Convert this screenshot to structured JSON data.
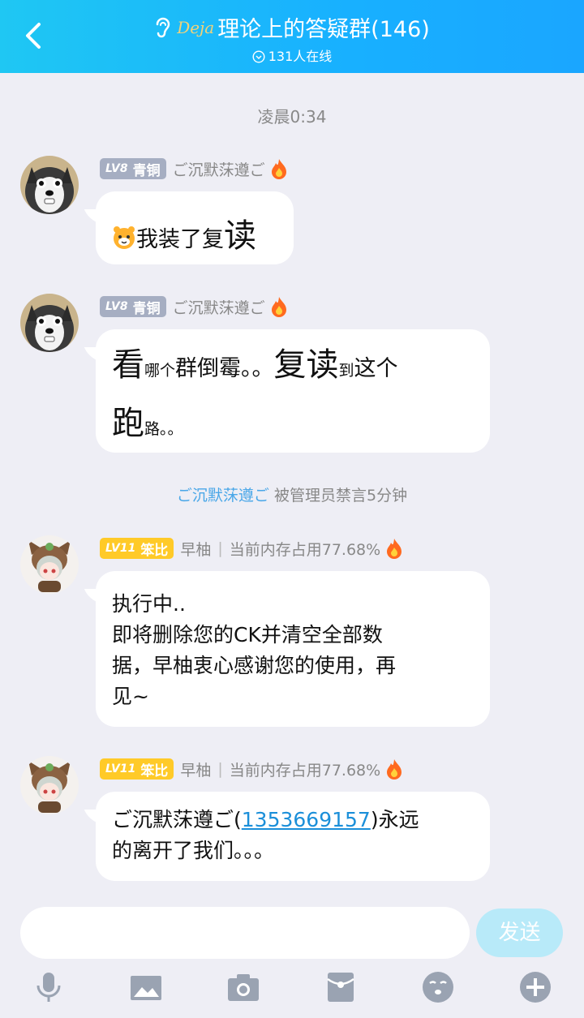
{
  "header": {
    "title": "理论上的答疑群(146)",
    "deja_logo": "Deja",
    "online": "131人在线"
  },
  "time_divider": "凌晨0:34",
  "messages": [
    {
      "level": "LV8",
      "rank": "青铜",
      "name": "ご沉默莯遵ご",
      "parts": [
        "我装了复",
        "读"
      ]
    },
    {
      "level": "LV8",
      "rank": "青铜",
      "name": "ご沉默莯遵ご",
      "parts": [
        "看",
        "哪个",
        "群倒霉。。",
        "复读",
        "到",
        "这个",
        "跑",
        "路。。"
      ]
    },
    {
      "level": "LV11",
      "rank": "笨比",
      "name": "早柚",
      "status": "当前内存占用77.68%",
      "text": [
        "执行中..",
        "即将删除您的CK并清空全部数",
        "据，早柚衷心感谢您的使用，再",
        "见~"
      ]
    },
    {
      "level": "LV11",
      "rank": "笨比",
      "name": "早柚",
      "status": "当前内存占用77.68%",
      "text_before": "ご沉默莯遵ご(",
      "link": "1353669157",
      "text_after": ")永远",
      "text_line2": "的离开了我们。。。"
    }
  ],
  "system_notice": {
    "who": "ご沉默莯遵ご",
    "text": " 被管理员禁言5分钟"
  },
  "input": {
    "send_label": "发送"
  },
  "colors": {
    "header": "#18b0ff",
    "badge_bronze": "#a6aec2",
    "badge_gold": "#ffca28",
    "link": "#1b8fd9"
  }
}
